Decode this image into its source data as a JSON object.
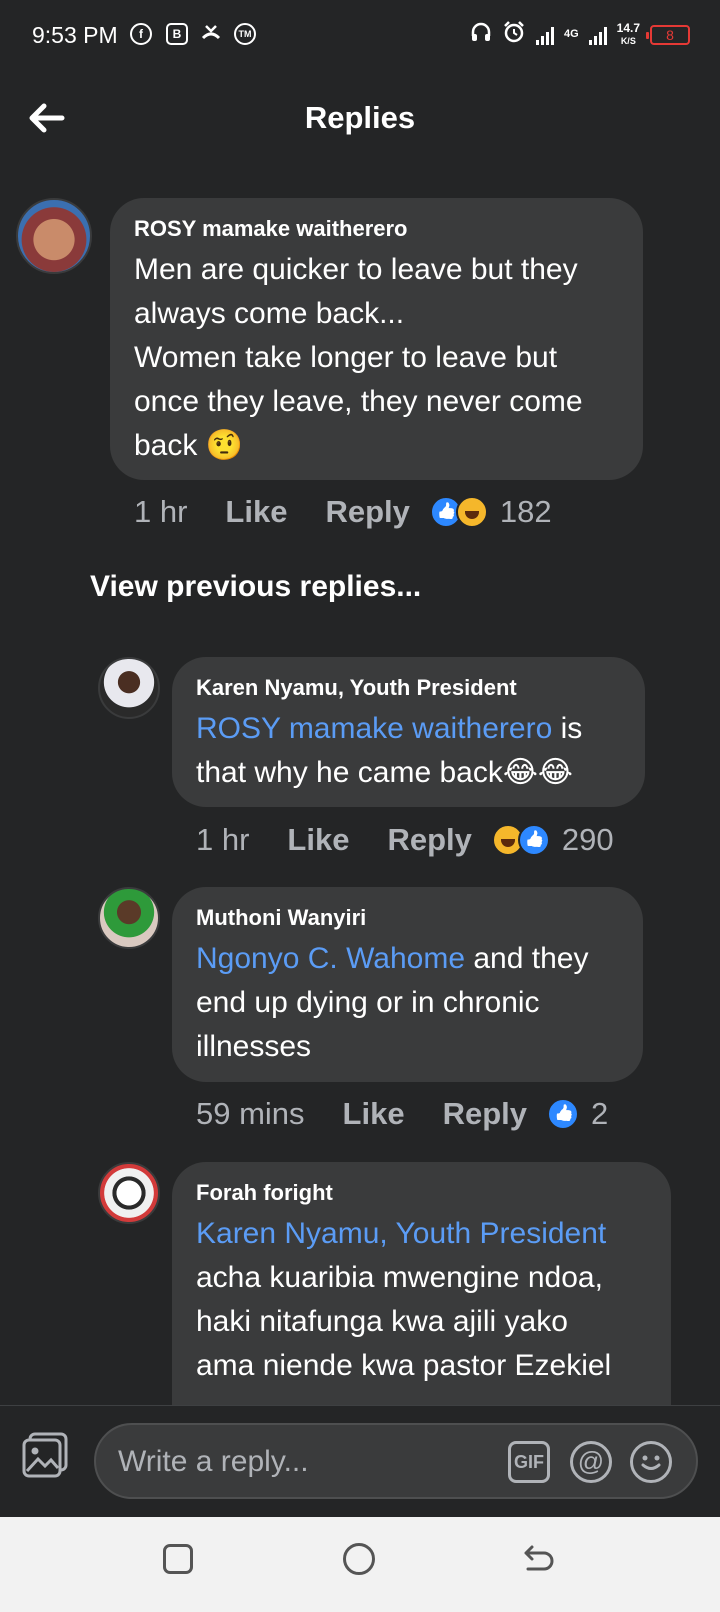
{
  "status_bar": {
    "time": "9:53 PM",
    "network_type": "4G",
    "net_speed": "14.7",
    "net_speed_unit": "K/S",
    "battery": "8"
  },
  "header": {
    "title": "Replies",
    "back_icon": "back-arrow-icon"
  },
  "top_comment": {
    "author": "ROSY mamake waitherero",
    "text_lines": [
      "Men are quicker to leave but they",
      "always come back...",
      "Women take longer to leave but",
      "once they leave, they never come",
      "back 🤨"
    ],
    "time": "1 hr",
    "like_label": "Like",
    "reply_label": "Reply",
    "reactions": [
      "like",
      "haha"
    ],
    "reaction_count": "182"
  },
  "view_previous_label": "View previous replies...",
  "replies": [
    {
      "author": "Karen Nyamu, Youth President",
      "mention": "ROSY mamake waitherero",
      "text_after_mention": " is",
      "text_line2": "that why he came back😂😂",
      "time": "1 hr",
      "like_label": "Like",
      "reply_label": "Reply",
      "reactions": [
        "haha",
        "like"
      ],
      "reaction_count": "290"
    },
    {
      "author": "Muthoni Wanyiri",
      "mention": "Ngonyo C. Wahome",
      "text_after_mention": " and they",
      "text_line2": "end up dying or in chronic",
      "text_line3": "illnesses",
      "time": "59 mins",
      "like_label": "Like",
      "reply_label": "Reply",
      "reactions": [
        "like"
      ],
      "reaction_count": "2"
    },
    {
      "author": "Forah foright",
      "mention": "Karen Nyamu, Youth President",
      "text_line2": "acha kuaribia mwengine ndoa,",
      "text_line3": "haki nitafunga kwa ajili yako",
      "text_line4": "ama niende kwa pastor Ezekiel"
    }
  ],
  "composer": {
    "placeholder": "Write a reply...",
    "gif_label": "GIF",
    "at_label": "@"
  },
  "colors": {
    "background": "#242526",
    "bubble": "#3a3b3c",
    "mention": "#5b9cf5",
    "like_blue": "#2d88ff",
    "haha_yellow": "#f5b72b"
  }
}
